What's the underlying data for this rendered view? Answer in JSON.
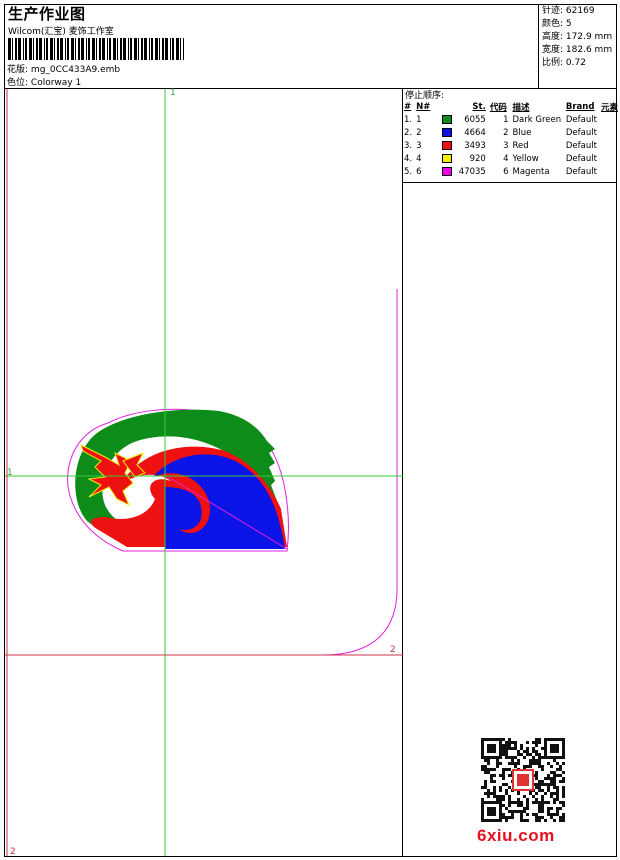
{
  "header": {
    "title": "生产作业图",
    "subtitle": "Wilcom(汇宝) 麦饰工作室",
    "design_label": "花版:",
    "design_value": "mg_0CC433A9.emb",
    "colorway_label": "色位:",
    "colorway_value": "Colorway 1"
  },
  "stats": [
    {
      "label": "针迹:",
      "value": "62169"
    },
    {
      "label": "颜色:",
      "value": "5"
    },
    {
      "label": "高度:",
      "value": "172.9 mm"
    },
    {
      "label": "宽度:",
      "value": "182.6 mm"
    },
    {
      "label": "比例:",
      "value": "0.72"
    }
  ],
  "stop_sequence": {
    "title": "停止顺序:",
    "columns": {
      "idx": "#",
      "n": "N#",
      "st": "St.",
      "code": "代码",
      "desc": "描述",
      "brand": "Brand",
      "elem": "元素"
    },
    "rows": [
      {
        "idx": "1.",
        "n": "1",
        "color": "#0d8c1a",
        "st": "6055",
        "code": "1",
        "desc": "Dark Green",
        "brand": "Default"
      },
      {
        "idx": "2.",
        "n": "2",
        "color": "#0a14e6",
        "st": "4664",
        "code": "2",
        "desc": "Blue",
        "brand": "Default"
      },
      {
        "idx": "3.",
        "n": "3",
        "color": "#ee1111",
        "st": "3493",
        "code": "3",
        "desc": "Red",
        "brand": "Default"
      },
      {
        "idx": "4.",
        "n": "4",
        "color": "#f2ee00",
        "st": "920",
        "code": "4",
        "desc": "Yellow",
        "brand": "Default"
      },
      {
        "idx": "5.",
        "n": "6",
        "color": "#ee00ee",
        "st": "47035",
        "code": "6",
        "desc": "Magenta",
        "brand": "Default"
      }
    ]
  },
  "axes": {
    "label_1": "1",
    "label_2": "2"
  },
  "watermark": "6xiu.com",
  "colors": {
    "axis_green": "#33cc33",
    "axis_red": "#cc3344",
    "outline_magenta": "#e020e0"
  }
}
